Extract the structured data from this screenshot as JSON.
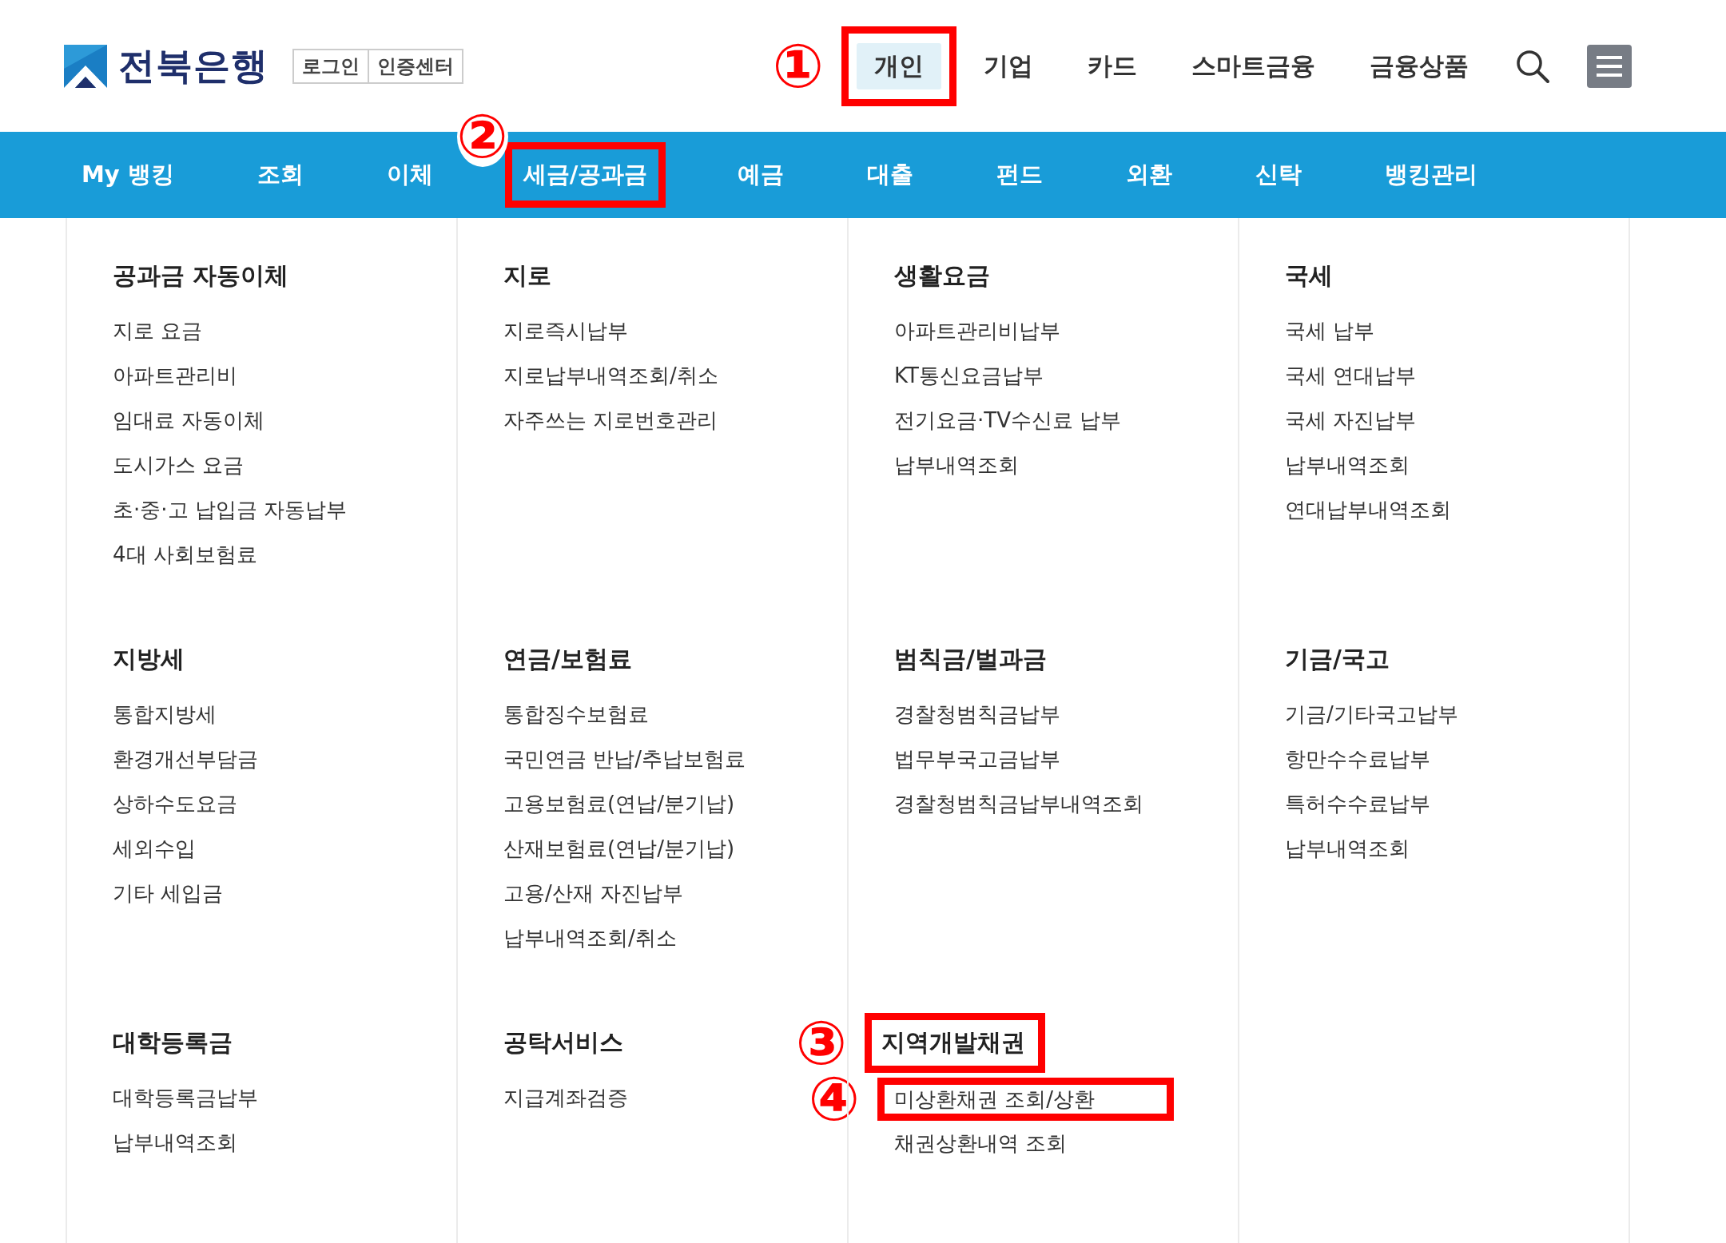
{
  "header": {
    "logo": "전북은행",
    "util_links": [
      "로그인",
      "인증센터"
    ],
    "nav": [
      {
        "label": "개인",
        "selected": true,
        "marker": "①"
      },
      {
        "label": "기업",
        "selected": false
      },
      {
        "label": "카드",
        "selected": false
      },
      {
        "label": "스마트금융",
        "selected": false
      },
      {
        "label": "금융상품",
        "selected": false
      }
    ]
  },
  "subnav": [
    {
      "label": "My 뱅킹"
    },
    {
      "label": "조회"
    },
    {
      "label": "이체"
    },
    {
      "label": "세금/공과금",
      "marker": "②"
    },
    {
      "label": "예금"
    },
    {
      "label": "대출"
    },
    {
      "label": "펀드"
    },
    {
      "label": "외환"
    },
    {
      "label": "신탁"
    },
    {
      "label": "뱅킹관리"
    }
  ],
  "menu_groups": [
    {
      "title": "공과금 자동이체",
      "items": [
        {
          "label": "지로 요금"
        },
        {
          "label": "아파트관리비"
        },
        {
          "label": "임대료 자동이체"
        },
        {
          "label": "도시가스 요금"
        },
        {
          "label": "초·중·고 납입금 자동납부"
        },
        {
          "label": "4대 사회보험료"
        }
      ]
    },
    {
      "title": "지로",
      "items": [
        {
          "label": "지로즉시납부"
        },
        {
          "label": "지로납부내역조회/취소"
        },
        {
          "label": "자주쓰는 지로번호관리"
        }
      ]
    },
    {
      "title": "생활요금",
      "items": [
        {
          "label": "아파트관리비납부"
        },
        {
          "label": "KT통신요금납부"
        },
        {
          "label": "전기요금·TV수신료 납부"
        },
        {
          "label": "납부내역조회"
        }
      ]
    },
    {
      "title": "국세",
      "items": [
        {
          "label": "국세 납부"
        },
        {
          "label": "국세 연대납부"
        },
        {
          "label": "국세 자진납부"
        },
        {
          "label": "납부내역조회"
        },
        {
          "label": "연대납부내역조회"
        }
      ]
    },
    {
      "title": "지방세",
      "items": [
        {
          "label": "통합지방세"
        },
        {
          "label": "환경개선부담금"
        },
        {
          "label": "상하수도요금"
        },
        {
          "label": "세외수입"
        },
        {
          "label": "기타 세입금"
        }
      ]
    },
    {
      "title": "연금/보험료",
      "items": [
        {
          "label": "통합징수보험료"
        },
        {
          "label": "국민연금 반납/추납보험료"
        },
        {
          "label": "고용보험료(연납/분기납)"
        },
        {
          "label": "산재보험료(연납/분기납)"
        },
        {
          "label": "고용/산재 자진납부"
        },
        {
          "label": "납부내역조회/취소"
        }
      ]
    },
    {
      "title": "범칙금/벌과금",
      "items": [
        {
          "label": "경찰청범칙금납부"
        },
        {
          "label": "법무부국고금납부"
        },
        {
          "label": "경찰청범칙금납부내역조회"
        }
      ]
    },
    {
      "title": "기금/국고",
      "items": [
        {
          "label": "기금/기타국고납부"
        },
        {
          "label": "항만수수료납부"
        },
        {
          "label": "특허수수료납부"
        },
        {
          "label": "납부내역조회"
        }
      ]
    },
    {
      "title": "대학등록금",
      "items": [
        {
          "label": "대학등록금납부"
        },
        {
          "label": "납부내역조회"
        }
      ]
    },
    {
      "title": "공탁서비스",
      "items": [
        {
          "label": "지급계좌검증"
        }
      ]
    },
    {
      "title": "지역개발채권",
      "marker": "③",
      "items": [
        {
          "label": "미상환채권 조회/상환",
          "marker": "④"
        },
        {
          "label": "채권상환내역 조회"
        }
      ]
    }
  ]
}
